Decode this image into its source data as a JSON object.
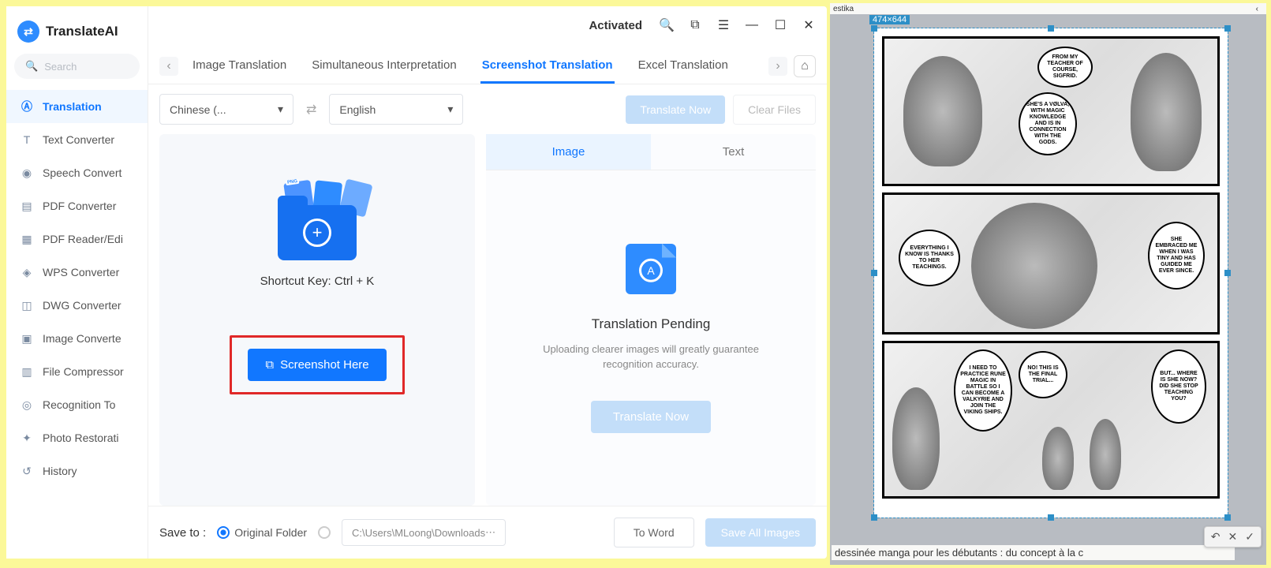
{
  "app": {
    "title": "TranslateAI"
  },
  "search": {
    "placeholder": "Search"
  },
  "sidebar": {
    "items": [
      {
        "label": "Translation",
        "active": true
      },
      {
        "label": "Text Converter"
      },
      {
        "label": "Speech Convert"
      },
      {
        "label": "PDF Converter"
      },
      {
        "label": "PDF Reader/Edi"
      },
      {
        "label": "WPS Converter"
      },
      {
        "label": "DWG Converter"
      },
      {
        "label": "Image Converte"
      },
      {
        "label": "File Compressor"
      },
      {
        "label": "Recognition To"
      },
      {
        "label": "Photo Restorati"
      },
      {
        "label": "History"
      }
    ]
  },
  "topbar": {
    "activated": "Activated"
  },
  "tabs": [
    {
      "label": "Image Translation"
    },
    {
      "label": "Simultaneous Interpretation"
    },
    {
      "label": "Screenshot Translation",
      "active": true
    },
    {
      "label": "Excel Translation"
    }
  ],
  "lang": {
    "source": "Chinese (...",
    "target": "English",
    "translate_now": "Translate Now",
    "clear_files": "Clear Files"
  },
  "left_panel": {
    "shortcut": "Shortcut Key: Ctrl + K",
    "button": "Screenshot Here",
    "png_tag": "PNG"
  },
  "right_panel": {
    "subtabs": {
      "image": "Image",
      "text": "Text"
    },
    "pending_title": "Translation Pending",
    "pending_sub": "Uploading clearer images will greatly guarantee recognition accuracy.",
    "translate_now": "Translate Now"
  },
  "bottom": {
    "save_to": "Save to :",
    "original_folder": "Original Folder",
    "path": "C:\\Users\\MLoong\\Downloads",
    "to_word": "To Word",
    "save_all": "Save All Images"
  },
  "rightside": {
    "top_text": "estika",
    "dim_badge": "474×644",
    "caption": "dessinée manga pour les débutants : du concept à la c",
    "bubbles": {
      "p1b1": "FROM MY TEACHER OF COURSE, SIGFRID.",
      "p1b2": "SHE'S A VØLVA, WITH MAGIC KNOWLEDGE AND IS IN CONNECTION WITH THE GODS.",
      "p2b1": "EVERYTHING I KNOW IS THANKS TO HER TEACHINGS.",
      "p2b2": "SHE EMBRACED ME WHEN I WAS TINY AND HAS GUIDED ME EVER SINCE.",
      "p3b1": "I NEED TO PRACTICE RUNE MAGIC IN BATTLE SO I CAN BECOME A VALKYRIE AND JOIN THE VIKING SHIPS.",
      "p3b2": "NO! THIS IS THE FINAL TRIAL...",
      "p3b3": "BUT... WHERE IS SHE NOW? DID SHE STOP TEACHING YOU?"
    }
  }
}
